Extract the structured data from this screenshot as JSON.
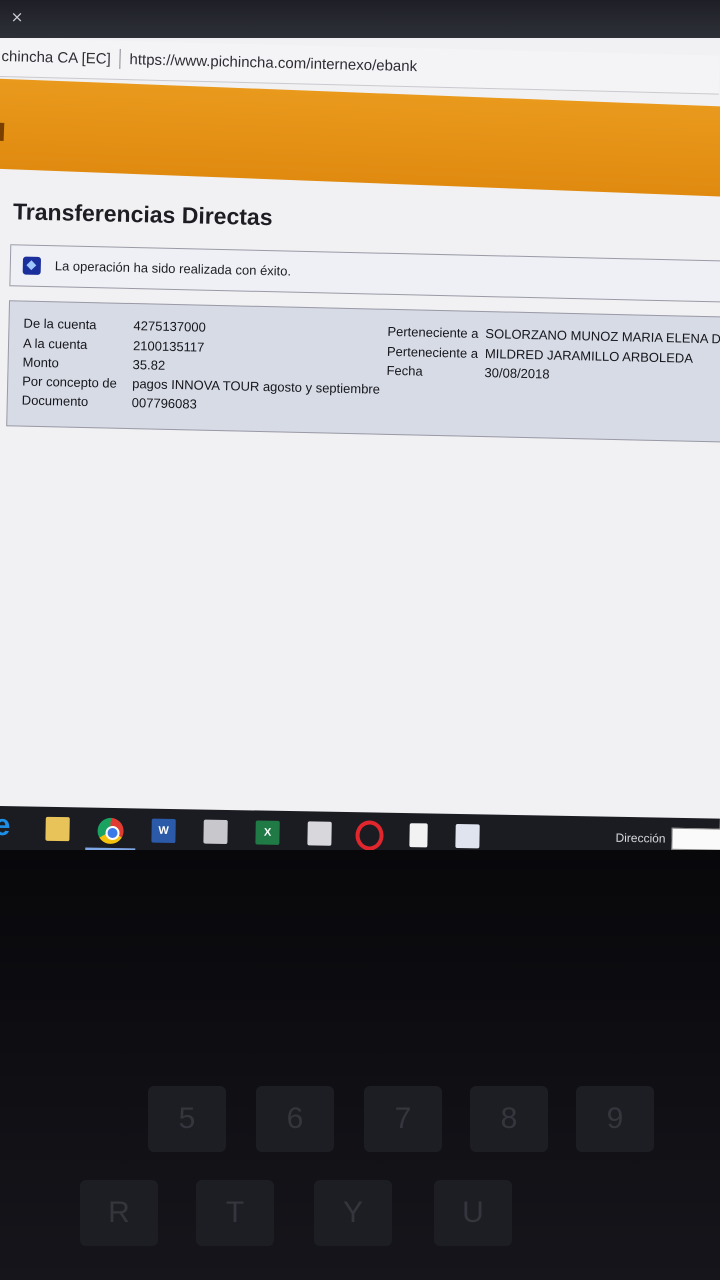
{
  "browser": {
    "tab_close_glyph": "×",
    "site_label": "chincha CA [EC]",
    "url": "https://www.pichincha.com/internexo/ebank"
  },
  "page": {
    "title": "Transferencias Directas",
    "message": "La operación ha sido realizada con éxito."
  },
  "transfer": {
    "from_label": "De la cuenta",
    "from_value": "4275137000",
    "from_owner_label": "Perteneciente a",
    "from_owner": "SOLORZANO MUNOZ MARIA ELENA DE",
    "to_label": "A la cuenta",
    "to_value": "2100135117",
    "to_owner_label": "Perteneciente a",
    "to_owner": "MILDRED JARAMILLO ARBOLEDA",
    "amount_label": "Monto",
    "amount_value": "35.82",
    "date_label": "Fecha",
    "date_value": "30/08/2018",
    "concept_label": "Por concepto de",
    "concept_value": "pagos INNOVA TOUR agosto y septiembre",
    "document_label": "Documento",
    "document_value": "007796083"
  },
  "taskbar": {
    "icons": [
      "edge-icon",
      "folder-icon",
      "chrome-icon",
      "word-icon",
      "calculator-icon",
      "excel-icon",
      "app-icon",
      "opera-icon",
      "notepad-icon",
      "photo-icon"
    ],
    "word_glyph": "W",
    "excel_glyph": "X",
    "address_label": "Dirección"
  },
  "keyboard": {
    "keys": [
      "5",
      "6",
      "7",
      "8",
      "9",
      "R",
      "T",
      "Y",
      "U"
    ]
  }
}
